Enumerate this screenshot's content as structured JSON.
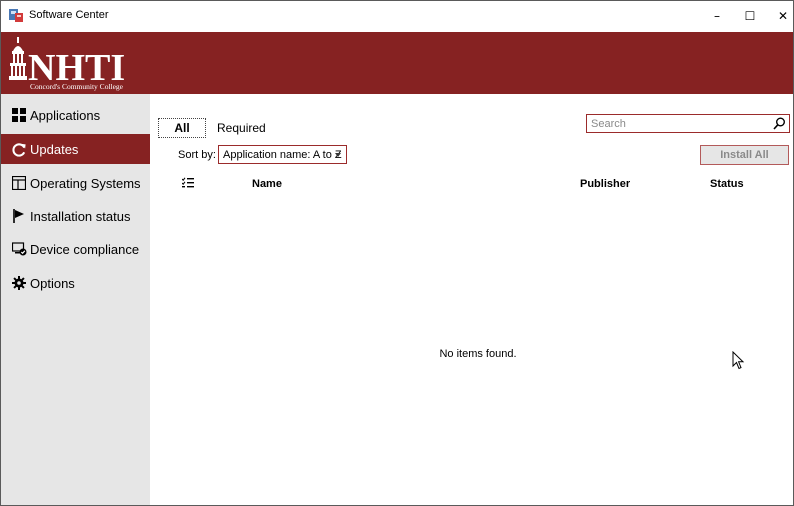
{
  "window": {
    "title": "Software Center",
    "controls": {
      "minimize": "–",
      "maximize": "☐",
      "close": "✕"
    }
  },
  "banner": {
    "logo_text": "NHTI",
    "logo_subtitle": "Concord's Community College",
    "background": "#862222"
  },
  "sidebar": {
    "items": [
      {
        "label": "Applications",
        "icon": "grid-icon",
        "active": false
      },
      {
        "label": "Updates",
        "icon": "refresh-icon",
        "active": true
      },
      {
        "label": "Operating Systems",
        "icon": "windows-icon",
        "active": false
      },
      {
        "label": "Installation status",
        "icon": "flag-icon",
        "active": false
      },
      {
        "label": "Device compliance",
        "icon": "shield-check-icon",
        "active": false
      },
      {
        "label": "Options",
        "icon": "gear-icon",
        "active": false
      }
    ]
  },
  "main": {
    "tabs": [
      {
        "label": "All",
        "selected": true
      },
      {
        "label": "Required",
        "selected": false
      }
    ],
    "search": {
      "placeholder": "Search",
      "value": ""
    },
    "sort": {
      "label": "Sort by:",
      "selected": "Application name: A to Z"
    },
    "install_all_label": "Install All",
    "columns": {
      "name": "Name",
      "publisher": "Publisher",
      "status": "Status"
    },
    "empty_message": "No items found."
  },
  "colors": {
    "accent": "#862222",
    "sidebar_bg": "#e6e6e6"
  }
}
